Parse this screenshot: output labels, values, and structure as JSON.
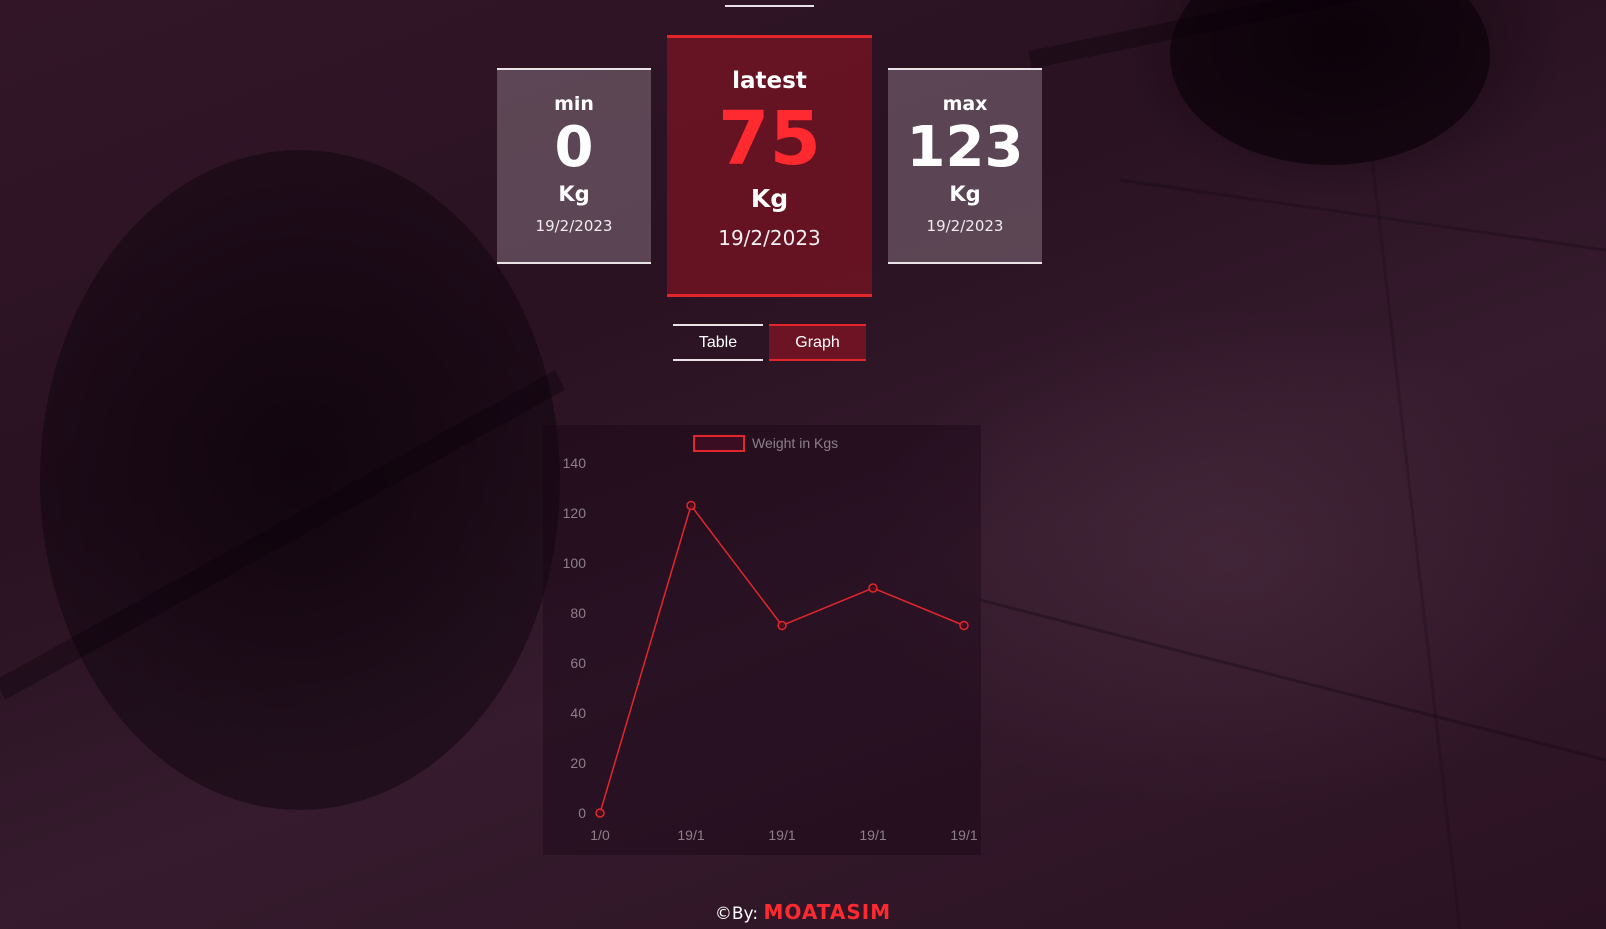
{
  "stats": {
    "min": {
      "label": "min",
      "value": "0",
      "unit": "Kg",
      "date": "19/2/2023"
    },
    "latest": {
      "label": "latest",
      "value": "75",
      "unit": "Kg",
      "date": "19/2/2023"
    },
    "max": {
      "label": "max",
      "value": "123",
      "unit": "Kg",
      "date": "19/2/2023"
    }
  },
  "tabs": {
    "table_label": "Table",
    "graph_label": "Graph",
    "active": "Graph"
  },
  "footer": {
    "prefix": "©By:",
    "author": "MOATASIM"
  },
  "colors": {
    "accent": "#e3262b",
    "accent_text": "#ff2a2f",
    "axis_text": "#8d7f8a",
    "legend_fill": "#3a0d22"
  },
  "chart_data": {
    "type": "line",
    "categories": [
      "1/0",
      "19/1",
      "19/1",
      "19/1",
      "19/1"
    ],
    "series": [
      {
        "name": "Weight in Kgs",
        "values": [
          0,
          123,
          75,
          90,
          75
        ]
      }
    ],
    "ylim": [
      0,
      140
    ],
    "yticks": [
      0,
      20,
      40,
      60,
      80,
      100,
      120,
      140
    ],
    "grid": false,
    "legend": "top"
  }
}
